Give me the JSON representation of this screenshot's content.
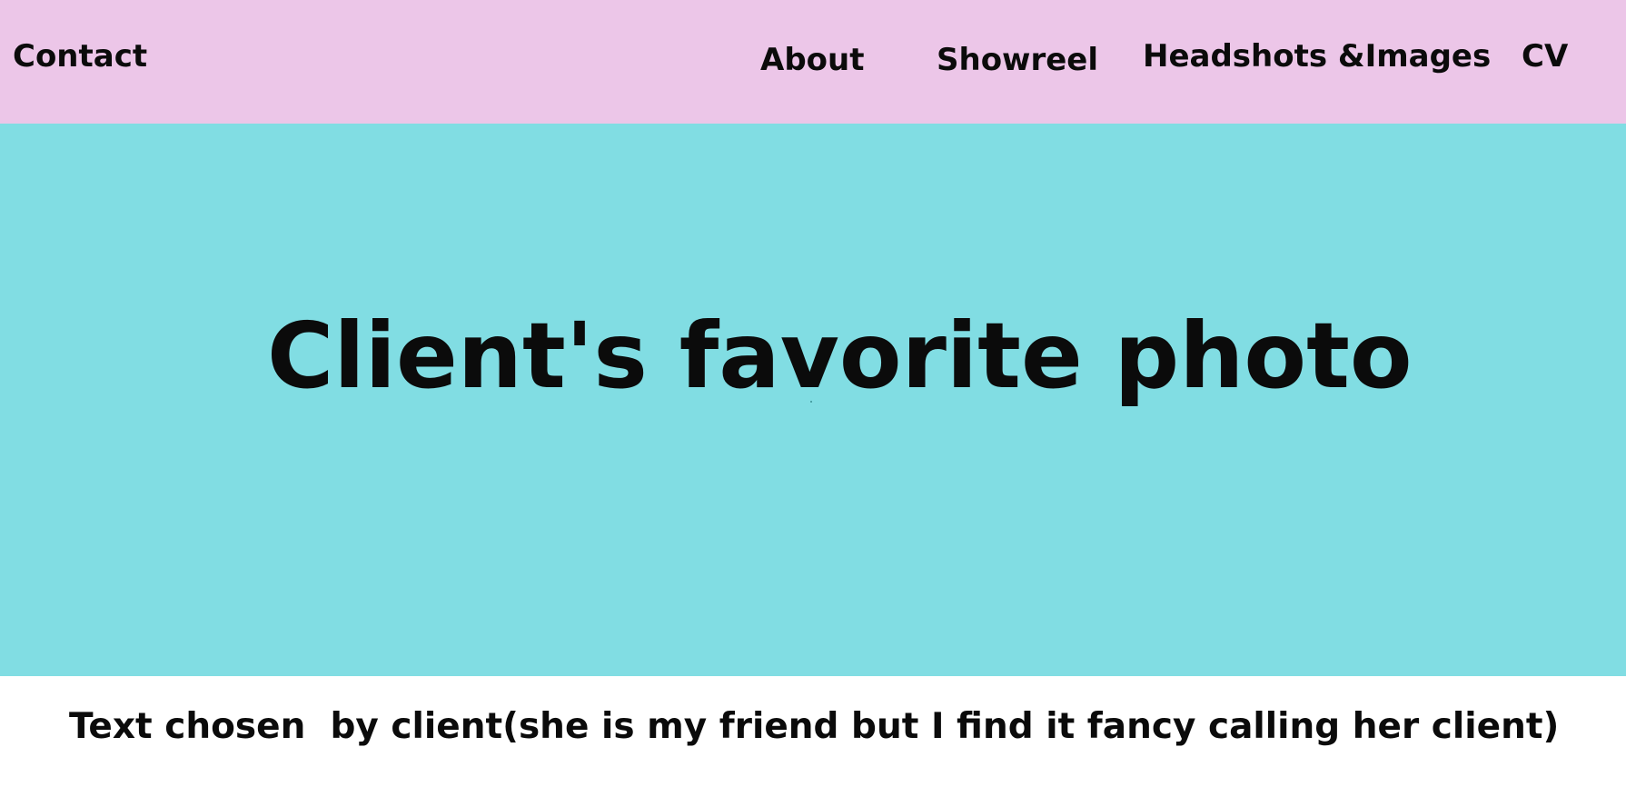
{
  "nav": {
    "contact": "Contact",
    "about": "About",
    "showreel": "Showreel",
    "headshots": "Headshots &Images",
    "cv": "CV"
  },
  "hero": {
    "title": "Client's favorite photo"
  },
  "caption": {
    "text": "Text chosen  by client(she is my friend but I find it fancy calling her client)"
  },
  "colors": {
    "navbar_bg": "#ecc6e8",
    "hero_bg": "#81dde3",
    "text": "#0b0b0b",
    "page_bg": "#ffffff"
  }
}
